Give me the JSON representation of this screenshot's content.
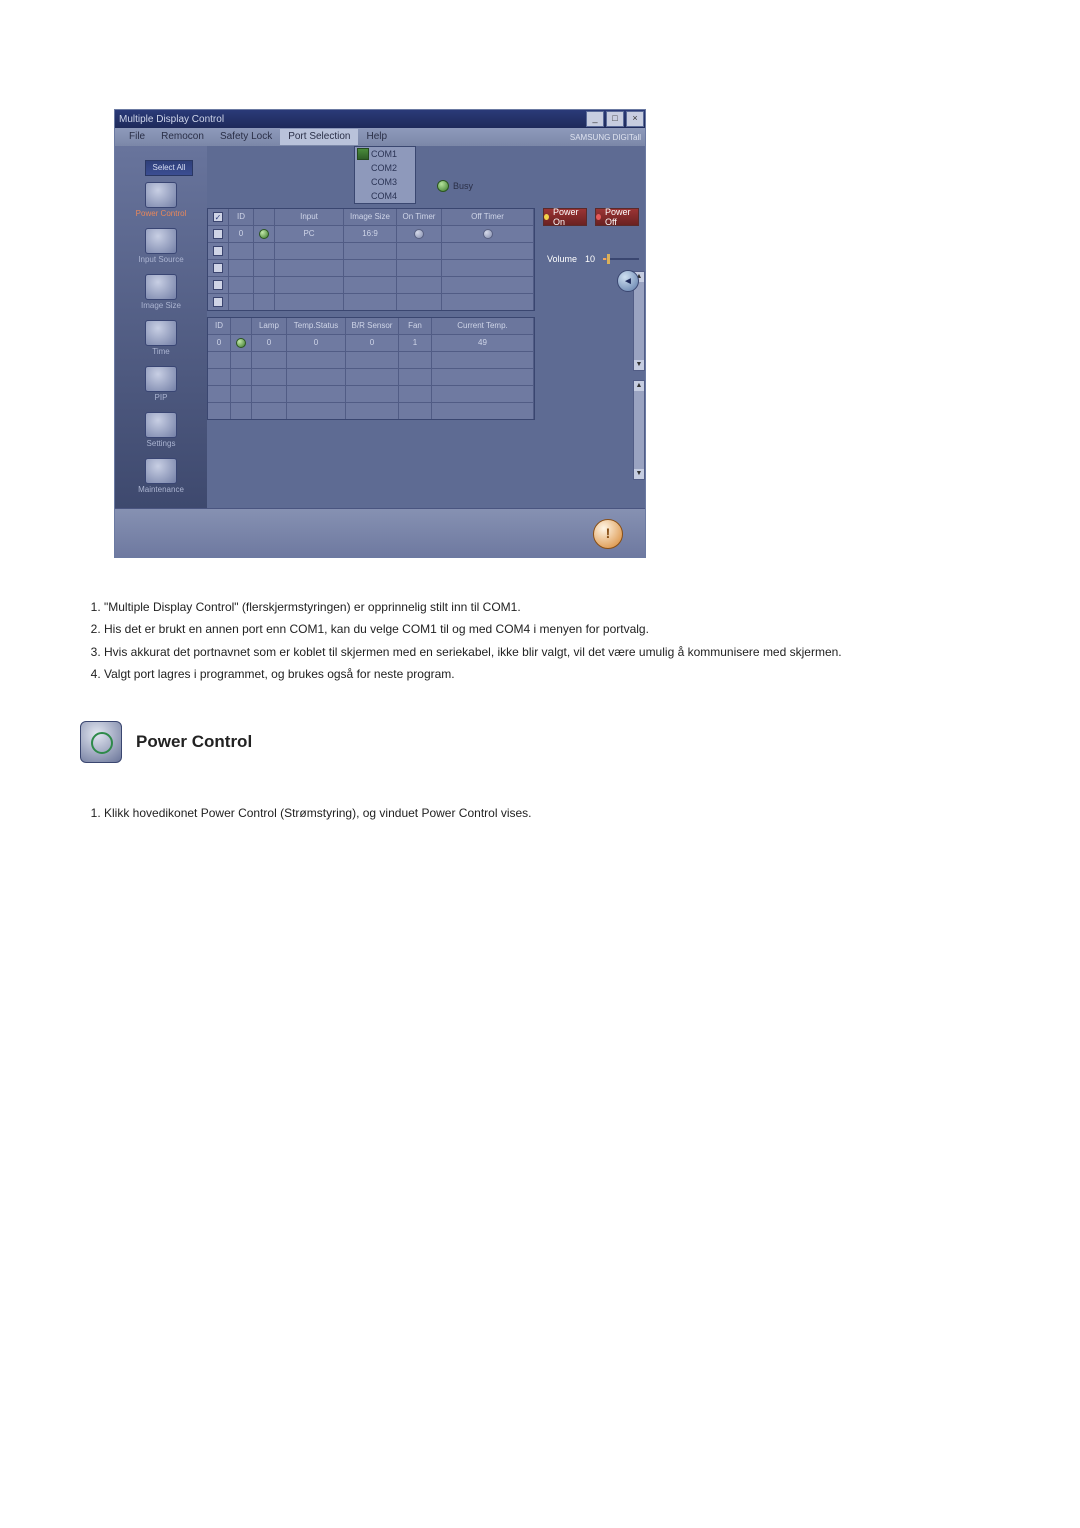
{
  "window": {
    "title": "Multiple Display Control",
    "brand": "SAMSUNG DIGITall"
  },
  "menu": {
    "file": "File",
    "remocon": "Remocon",
    "safety_lock": "Safety Lock",
    "port_selection": "Port Selection",
    "help": "Help"
  },
  "com_ports": {
    "items": [
      "COM1",
      "COM2",
      "COM3",
      "COM4"
    ]
  },
  "busy_label": "Busy",
  "sidebar": {
    "select_all": "Select All",
    "items": [
      {
        "label": "Power Control",
        "name": "power-control"
      },
      {
        "label": "Input Source",
        "name": "input-source"
      },
      {
        "label": "Image Size",
        "name": "image-size"
      },
      {
        "label": "Time",
        "name": "time"
      },
      {
        "label": "PIP",
        "name": "pip"
      },
      {
        "label": "Settings",
        "name": "settings"
      },
      {
        "label": "Maintenance",
        "name": "maintenance"
      }
    ]
  },
  "table1": {
    "headers": {
      "chk": "",
      "id": "ID",
      "status": "",
      "input": "Input",
      "image_size": "Image Size",
      "on_timer": "On Timer",
      "off_timer": "Off Timer"
    },
    "rows": [
      {
        "id": "0",
        "input": "PC",
        "image_size": "16:9"
      }
    ]
  },
  "table2": {
    "headers": {
      "id": "ID",
      "status": "",
      "lamp": "Lamp",
      "temp_status": "Temp.Status",
      "br_sensor": "B/R Sensor",
      "fan": "Fan",
      "current_temp": "Current Temp."
    },
    "rows": [
      {
        "id": "0",
        "lamp": "0",
        "temp_status": "0",
        "br_sensor": "0",
        "fan": "1",
        "current_temp": "49"
      }
    ]
  },
  "power": {
    "on_label": "Power On",
    "off_label": "Power Off",
    "volume_label": "Volume",
    "volume_value": "10"
  },
  "doc": {
    "list": [
      "\"Multiple Display Control\" (flerskjermstyringen) er opprinnelig stilt inn til COM1.",
      "His det er brukt en annen port enn COM1, kan du velge COM1 til og med COM4 i menyen for portvalg.",
      "Hvis akkurat det portnavnet som er koblet til skjermen med en seriekabel, ikke blir valgt, vil det være umulig å kommunisere med skjermen.",
      "Valgt port lagres i programmet, og brukes også for neste program."
    ],
    "section_title": "Power Control",
    "list2": [
      "Klikk hovedikonet Power Control (Strømstyring), og vinduet Power Control vises."
    ]
  }
}
